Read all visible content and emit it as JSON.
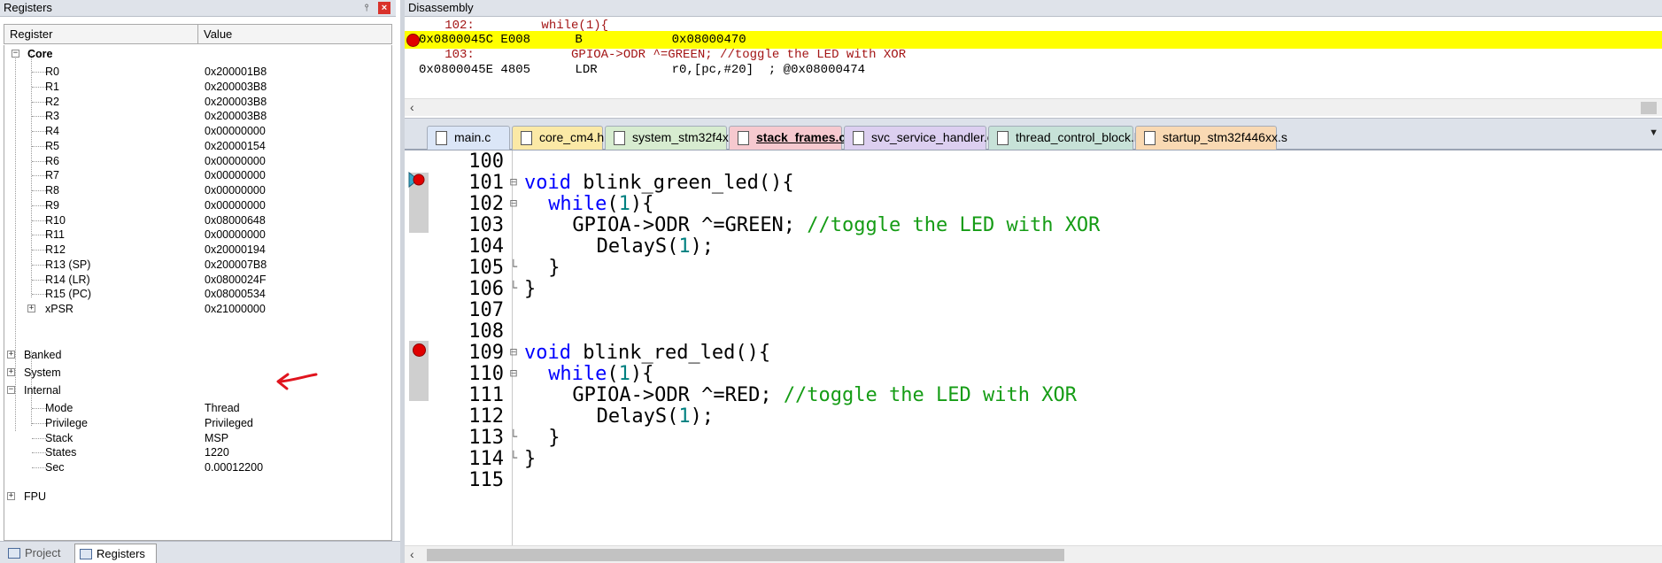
{
  "registers_panel": {
    "title": "Registers",
    "pin_icon": "pin-icon",
    "close_icon": "close-icon",
    "columns": {
      "register": "Register",
      "value": "Value"
    },
    "groups": {
      "core": "Core",
      "banked": "Banked",
      "system": "System",
      "internal": "Internal",
      "fpu": "FPU"
    },
    "core_registers": [
      {
        "name": "R0",
        "value": "0x200001B8"
      },
      {
        "name": "R1",
        "value": "0x200003B8"
      },
      {
        "name": "R2",
        "value": "0x200003B8"
      },
      {
        "name": "R3",
        "value": "0x200003B8"
      },
      {
        "name": "R4",
        "value": "0x00000000"
      },
      {
        "name": "R5",
        "value": "0x20000154"
      },
      {
        "name": "R6",
        "value": "0x00000000"
      },
      {
        "name": "R7",
        "value": "0x00000000"
      },
      {
        "name": "R8",
        "value": "0x00000000"
      },
      {
        "name": "R9",
        "value": "0x00000000"
      },
      {
        "name": "R10",
        "value": "0x08000648"
      },
      {
        "name": "R11",
        "value": "0x00000000"
      },
      {
        "name": "R12",
        "value": "0x20000194"
      },
      {
        "name": "R13 (SP)",
        "value": "0x200007B8"
      },
      {
        "name": "R14 (LR)",
        "value": "0x0800024F"
      },
      {
        "name": "R15 (PC)",
        "value": "0x08000534"
      },
      {
        "name": "xPSR",
        "value": "0x21000000"
      }
    ],
    "internal_items": [
      {
        "name": "Mode",
        "value": "Thread"
      },
      {
        "name": "Privilege",
        "value": "Privileged"
      },
      {
        "name": "Stack",
        "value": "MSP"
      },
      {
        "name": "States",
        "value": "1220"
      },
      {
        "name": "Sec",
        "value": "0.00012200"
      }
    ],
    "bottom_tabs": {
      "project": "Project",
      "registers": "Registers"
    },
    "annotation_color": "#e0141e"
  },
  "disassembly": {
    "title": "Disassembly",
    "lines": [
      {
        "text": "   102:         while(1){",
        "kind": "source"
      },
      {
        "text": "0x0800045C E008      B            0x08000470",
        "kind": "current"
      },
      {
        "text": "   103:             GPIOA->ODR ^=GREEN; //toggle the LED with XOR",
        "kind": "source"
      },
      {
        "text": "0x0800045E 4805      LDR          r0,[pc,#20]  ; @0x08000474",
        "kind": "asm"
      }
    ],
    "highlight_color": "#ffff00"
  },
  "editor": {
    "tabs": [
      {
        "label": "main.c",
        "color": "#dbe6f7"
      },
      {
        "label": "core_cm4.h",
        "color": "#fbe9a6"
      },
      {
        "label": "system_stm32f4xx.c",
        "color": "#d7ecd0"
      },
      {
        "label": "stack_frames.c",
        "color": "#f6c9cf"
      },
      {
        "label": "svc_service_handler.c",
        "color": "#dccff0"
      },
      {
        "label": "thread_control_block.h",
        "color": "#c7e2d8"
      },
      {
        "label": "startup_stm32f446xx.s",
        "color": "#f9d9b3"
      }
    ],
    "active_tab": "stack_frames.c",
    "line_numbers": [
      "100",
      "101",
      "102",
      "103",
      "104",
      "105",
      "106",
      "107",
      "108",
      "109",
      "110",
      "111",
      "112",
      "113",
      "114",
      "115"
    ],
    "code": {
      "l101_kw": "void",
      "l101_rest": " blink_green_led(){",
      "l102_kw": "while",
      "l102_num": "1",
      "l103_code": "GPIOA->ODR ^=GREEN; ",
      "l103_comment": "//toggle the LED with XOR",
      "l104_code": "DelayS(",
      "l104_num": "1",
      "l105": "}",
      "l106": "}",
      "l109_kw": "void",
      "l109_rest": " blink_red_led(){",
      "l110_kw": "while",
      "l110_num": "1",
      "l111_code": "GPIOA->ODR ^=RED; ",
      "l111_comment": "//toggle the LED with XOR",
      "l112_code": "DelayS(",
      "l112_num": "1",
      "l113": "}",
      "l114": "}"
    }
  }
}
